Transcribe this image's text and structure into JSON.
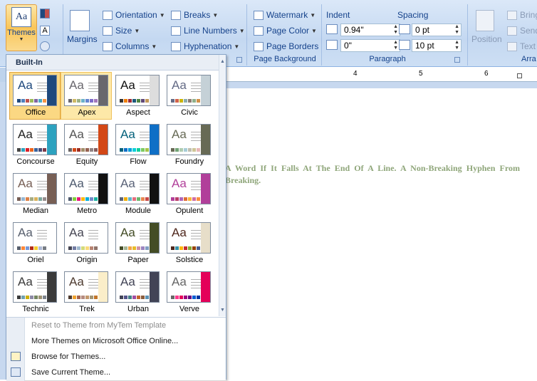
{
  "ribbon": {
    "themes_button": {
      "label": "Themes",
      "icon": "themes-icon",
      "glyph": "Aa"
    },
    "page_setup": {
      "margins_label": "Margins",
      "orientation_label": "Orientation",
      "size_label": "Size",
      "columns_label": "Columns",
      "breaks_label": "Breaks",
      "line_numbers_label": "Line Numbers",
      "hyphenation_label": "Hyphenation"
    },
    "page_background": {
      "group_label": "Page Background",
      "watermark_label": "Watermark",
      "page_color_label": "Page Color",
      "page_borders_label": "Page Borders"
    },
    "paragraph": {
      "group_label": "Paragraph",
      "indent_label": "Indent",
      "spacing_label": "Spacing",
      "indent_left": "0.94\"",
      "indent_right": "0\"",
      "spacing_before": "0 pt",
      "spacing_after": "10 pt"
    },
    "arrange": {
      "position_label": "Position",
      "bring_label": "Bring",
      "send_label": "Send",
      "text_label": "Text",
      "group_label": "Arra"
    }
  },
  "ruler": {
    "numbers": [
      "4",
      "5",
      "6"
    ]
  },
  "document": {
    "text": "A Word If It Falls At The End Of A Line. A Non-Breaking Hyphen From Breaking."
  },
  "gallery": {
    "header": "Built-In",
    "themes": [
      {
        "name": "Office",
        "colors": [
          "#1f497d",
          "#4f81bd",
          "#c0504d",
          "#9bbb59",
          "#8064a2",
          "#4bacc6",
          "#f79646"
        ],
        "bar": "#1f497d",
        "aa_color": "#1f497d"
      },
      {
        "name": "Apex",
        "colors": [
          "#69676d",
          "#ceb966",
          "#9cb084",
          "#6bb1c9",
          "#6585cf",
          "#7e6bc9",
          "#a379bb"
        ],
        "bar": "#69676d",
        "aa_color": "#69676d"
      },
      {
        "name": "Aspect",
        "colors": [
          "#323232",
          "#f07f09",
          "#9f2936",
          "#1b587c",
          "#4e8542",
          "#604878",
          "#c19859"
        ],
        "bar": "#dddddd",
        "aa_color": "#111111"
      },
      {
        "name": "Civic",
        "colors": [
          "#646b86",
          "#d16349",
          "#ccb400",
          "#8cadae",
          "#8c7b70",
          "#8fb08c",
          "#d19049"
        ],
        "bar": "#c5d1d7",
        "aa_color": "#646b86"
      },
      {
        "name": "Concourse",
        "colors": [
          "#464646",
          "#2da2bf",
          "#da1f28",
          "#eb641b",
          "#39639d",
          "#474b78",
          "#7d3c4a"
        ],
        "bar": "#2da2bf",
        "aa_color": "#222222"
      },
      {
        "name": "Equity",
        "colors": [
          "#696464",
          "#d34817",
          "#9b2d1f",
          "#a28e6a",
          "#956251",
          "#918485",
          "#855d5d"
        ],
        "bar": "#d34817",
        "aa_color": "#555555"
      },
      {
        "name": "Flow",
        "colors": [
          "#04617b",
          "#0f6fc6",
          "#009dd9",
          "#0bd0d9",
          "#10cf9b",
          "#7cca62",
          "#a5c249"
        ],
        "bar": "#0f6fc6",
        "aa_color": "#04617b"
      },
      {
        "name": "Foundry",
        "colors": [
          "#676a55",
          "#72a376",
          "#b0ccb0",
          "#a8cdd7",
          "#c0beaf",
          "#cec597",
          "#e8b7b7"
        ],
        "bar": "#676a55",
        "aa_color": "#676a55"
      },
      {
        "name": "Median",
        "colors": [
          "#775f55",
          "#94b6d2",
          "#dd8047",
          "#a5ab81",
          "#d8b25c",
          "#7ba79d",
          "#968c8c"
        ],
        "bar": "#775f55",
        "aa_color": "#775f55"
      },
      {
        "name": "Metro",
        "colors": [
          "#4e5b6f",
          "#7fd13b",
          "#ea157a",
          "#feb80a",
          "#00addc",
          "#738ac8",
          "#1ab39f"
        ],
        "bar": "#111111",
        "aa_color": "#4e5b6f"
      },
      {
        "name": "Module",
        "colors": [
          "#5a6378",
          "#f0ad00",
          "#60b5cc",
          "#e66c7d",
          "#6bb76d",
          "#e88651",
          "#c64847"
        ],
        "bar": "#111111",
        "aa_color": "#5a6378"
      },
      {
        "name": "Opulent",
        "colors": [
          "#b13f9a",
          "#b83d68",
          "#ac66bb",
          "#de6c36",
          "#f9b639",
          "#cf6da4",
          "#fa8d3d"
        ],
        "bar": "#b13f9a",
        "aa_color": "#b13f9a"
      },
      {
        "name": "Oriel",
        "colors": [
          "#575f6d",
          "#fe8637",
          "#7598d9",
          "#b32c16",
          "#f5cd2d",
          "#aebad5",
          "#777c84"
        ],
        "bar": "#ffffff",
        "aa_color": "#575f6d"
      },
      {
        "name": "Origin",
        "colors": [
          "#464653",
          "#727ca3",
          "#9fb8cd",
          "#d2da7a",
          "#fada7a",
          "#b88472",
          "#8e736a"
        ],
        "bar": "#ffffff",
        "aa_color": "#464653"
      },
      {
        "name": "Paper",
        "colors": [
          "#444d26",
          "#a5b592",
          "#f3a447",
          "#e7bc29",
          "#d092a7",
          "#9c85c0",
          "#809ec2"
        ],
        "bar": "#444d26",
        "aa_color": "#444d26"
      },
      {
        "name": "Solstice",
        "colors": [
          "#4f271c",
          "#3891a7",
          "#feb80a",
          "#c32d2e",
          "#84aa33",
          "#964305",
          "#475a8d"
        ],
        "bar": "#e7dec9",
        "aa_color": "#4f271c"
      },
      {
        "name": "Technic",
        "colors": [
          "#3b3b3b",
          "#6ea0b0",
          "#ccaf0a",
          "#8d89a4",
          "#748560",
          "#9e9273",
          "#7e848d"
        ],
        "bar": "#3b3b3b",
        "aa_color": "#3b3b3b"
      },
      {
        "name": "Trek",
        "colors": [
          "#4e3b30",
          "#f0a22e",
          "#a5644e",
          "#b58b80",
          "#c3986d",
          "#a19574",
          "#c17529"
        ],
        "bar": "#fbeec9",
        "aa_color": "#4e3b30"
      },
      {
        "name": "Urban",
        "colors": [
          "#424456",
          "#53548a",
          "#438086",
          "#a04da3",
          "#c4652d",
          "#8b5d3d",
          "#5c92b5"
        ],
        "bar": "#424456",
        "aa_color": "#424456"
      },
      {
        "name": "Verve",
        "colors": [
          "#666666",
          "#ff388c",
          "#e40059",
          "#9c007f",
          "#68007f",
          "#005bd3",
          "#00349e"
        ],
        "bar": "#e40059",
        "aa_color": "#666666"
      }
    ],
    "menu": [
      {
        "label": "Reset to Theme from MyTem Template",
        "disabled": true
      },
      {
        "label": "More Themes on Microsoft Office Online...",
        "disabled": false
      },
      {
        "label": "Browse for Themes...",
        "disabled": false
      },
      {
        "label": "Save Current Theme...",
        "disabled": false
      }
    ]
  }
}
